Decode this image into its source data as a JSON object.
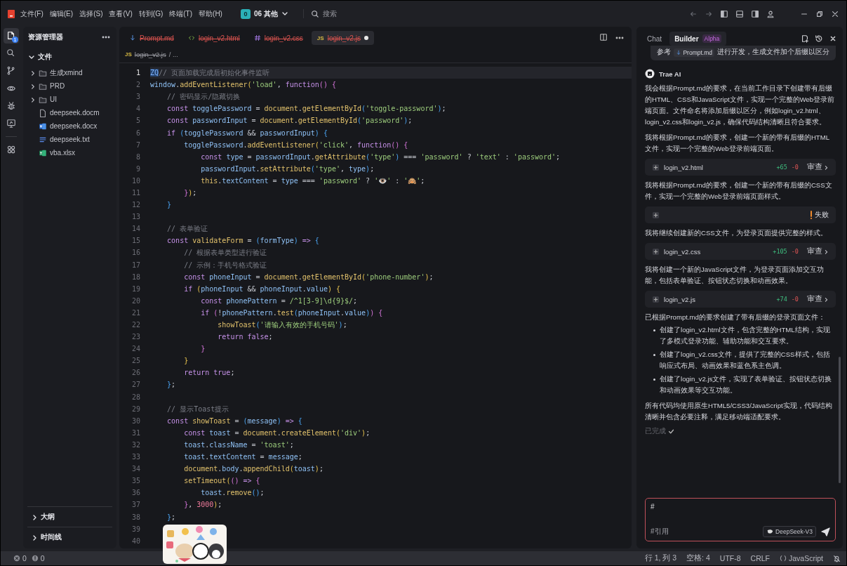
{
  "menu": [
    "文件(F)",
    "编辑(E)",
    "选择(S)",
    "查看(V)",
    "转到(G)",
    "终端(T)",
    "帮助(H)"
  ],
  "workspace": {
    "initial": "0",
    "name": "06 其他"
  },
  "search": {
    "placeholder": "搜索"
  },
  "activity_bar": [
    {
      "selected": true,
      "badge": "1"
    },
    {
      "selected": false
    },
    {
      "selected": false
    },
    {
      "selected": false
    },
    {
      "selected": false
    },
    {
      "selected": false
    },
    {
      "selected": false
    }
  ],
  "explorer": {
    "title": "资源管理器",
    "section": {
      "label": "文件",
      "expanded": true
    },
    "items": [
      {
        "name": "生成xmind",
        "kind": "folder",
        "expanded": false
      },
      {
        "name": "PRD",
        "kind": "folder",
        "expanded": false
      },
      {
        "name": "UI",
        "kind": "folder",
        "expanded": false
      },
      {
        "name": "deepseek.docm",
        "kind": "file"
      },
      {
        "name": "deepseek.docx",
        "kind": "word"
      },
      {
        "name": "deepseek.txt",
        "kind": "text"
      },
      {
        "name": "vba.xlsx",
        "kind": "excel"
      }
    ],
    "panels": [
      {
        "label": "大纲",
        "expanded": false
      },
      {
        "label": "时间线",
        "expanded": false
      }
    ]
  },
  "tabs": [
    {
      "label": "Prompt.md",
      "kind": "md",
      "selected": false,
      "deleted": true,
      "modified": false
    },
    {
      "label": "login_v2.html",
      "kind": "html",
      "selected": false,
      "deleted": true,
      "modified": false
    },
    {
      "label": "login_v2.css",
      "kind": "css",
      "selected": false,
      "deleted": true,
      "modified": false
    },
    {
      "label": "login_v2.js",
      "kind": "js",
      "icon_text": "JS",
      "selected": true,
      "deleted": true,
      "modified": true
    }
  ],
  "breadcrumb": {
    "icon_text": "JS",
    "file": "login_v2.js",
    "deleted": true,
    "rest": "/ ..."
  },
  "editor": {
    "lines": [
      {
        "n": "1",
        "selected": true,
        "tokens": [
          {
            "kind": "sel",
            "text": "ZQ"
          },
          {
            "kind": "cm",
            "text": "// 页面加载完成后初始化事件监听"
          }
        ]
      },
      {
        "n": "2",
        "selected": false,
        "tokens": [
          {
            "kind": "var",
            "text": "window"
          },
          {
            "kind": "p",
            "text": "."
          },
          {
            "kind": "fn",
            "text": "addEventListener"
          },
          {
            "kind": "b1",
            "text": "("
          },
          {
            "kind": "str",
            "text": "'load'"
          },
          {
            "kind": "p",
            "text": ", "
          },
          {
            "kind": "kw",
            "text": "function"
          },
          {
            "kind": "b2",
            "text": "()"
          },
          {
            "kind": "b2",
            "text": " {"
          }
        ]
      },
      {
        "n": "3",
        "selected": false,
        "tokens": [
          {
            "kind": "cm",
            "text": "    // 密码显示/隐藏切换"
          }
        ]
      },
      {
        "n": "4",
        "selected": false,
        "tokens": [
          {
            "kind": "kw",
            "text": "    const "
          },
          {
            "kind": "var",
            "text": "togglePassword"
          },
          {
            "kind": "p",
            "text": " = "
          },
          {
            "kind": "fn",
            "text": "document"
          },
          {
            "kind": "p",
            "text": "."
          },
          {
            "kind": "fn",
            "text": "getElementById"
          },
          {
            "kind": "b3",
            "text": "("
          },
          {
            "kind": "str",
            "text": "'toggle-password'"
          },
          {
            "kind": "b3",
            "text": ")"
          },
          {
            "kind": "p",
            "text": ";"
          }
        ]
      },
      {
        "n": "5",
        "selected": false,
        "tokens": [
          {
            "kind": "kw",
            "text": "    const "
          },
          {
            "kind": "var",
            "text": "passwordInput"
          },
          {
            "kind": "p",
            "text": " = "
          },
          {
            "kind": "fn",
            "text": "document"
          },
          {
            "kind": "p",
            "text": "."
          },
          {
            "kind": "fn",
            "text": "getElementById"
          },
          {
            "kind": "b3",
            "text": "("
          },
          {
            "kind": "str",
            "text": "'password'"
          },
          {
            "kind": "b3",
            "text": ")"
          },
          {
            "kind": "p",
            "text": ";"
          }
        ]
      },
      {
        "n": "6",
        "selected": false,
        "tokens": [
          {
            "kind": "kw",
            "text": "    if "
          },
          {
            "kind": "b3",
            "text": "("
          },
          {
            "kind": "var",
            "text": "togglePassword"
          },
          {
            "kind": "p",
            "text": " && "
          },
          {
            "kind": "var",
            "text": "passwordInput"
          },
          {
            "kind": "b3",
            "text": ")"
          },
          {
            "kind": "b3",
            "text": " {"
          }
        ]
      },
      {
        "n": "7",
        "selected": false,
        "tokens": [
          {
            "kind": "var",
            "text": "        togglePassword"
          },
          {
            "kind": "p",
            "text": "."
          },
          {
            "kind": "fn",
            "text": "addEventListener"
          },
          {
            "kind": "b1",
            "text": "("
          },
          {
            "kind": "str",
            "text": "'click'"
          },
          {
            "kind": "p",
            "text": ", "
          },
          {
            "kind": "kw",
            "text": "function"
          },
          {
            "kind": "b2",
            "text": "()"
          },
          {
            "kind": "b2",
            "text": " {"
          }
        ]
      },
      {
        "n": "8",
        "selected": false,
        "tokens": [
          {
            "kind": "kw",
            "text": "            const "
          },
          {
            "kind": "var",
            "text": "type"
          },
          {
            "kind": "p",
            "text": " = "
          },
          {
            "kind": "var",
            "text": "passwordInput"
          },
          {
            "kind": "p",
            "text": "."
          },
          {
            "kind": "fn",
            "text": "getAttribute"
          },
          {
            "kind": "b3",
            "text": "("
          },
          {
            "kind": "str",
            "text": "'type'"
          },
          {
            "kind": "b3",
            "text": ")"
          },
          {
            "kind": "p",
            "text": " === "
          },
          {
            "kind": "str",
            "text": "'password'"
          },
          {
            "kind": "p",
            "text": " ? "
          },
          {
            "kind": "str",
            "text": "'text'"
          },
          {
            "kind": "p",
            "text": " : "
          },
          {
            "kind": "str",
            "text": "'password'"
          },
          {
            "kind": "p",
            "text": ";"
          }
        ]
      },
      {
        "n": "9",
        "selected": false,
        "tokens": [
          {
            "kind": "var",
            "text": "            passwordInput"
          },
          {
            "kind": "p",
            "text": "."
          },
          {
            "kind": "fn",
            "text": "setAttribute"
          },
          {
            "kind": "b3",
            "text": "("
          },
          {
            "kind": "str",
            "text": "'type'"
          },
          {
            "kind": "p",
            "text": ", "
          },
          {
            "kind": "var",
            "text": "type"
          },
          {
            "kind": "b3",
            "text": ")"
          },
          {
            "kind": "p",
            "text": ";"
          }
        ]
      },
      {
        "n": "10",
        "selected": false,
        "tokens": [
          {
            "kind": "fn",
            "text": "            this"
          },
          {
            "kind": "p",
            "text": "."
          },
          {
            "kind": "var",
            "text": "textContent"
          },
          {
            "kind": "p",
            "text": " = "
          },
          {
            "kind": "var",
            "text": "type"
          },
          {
            "kind": "p",
            "text": " === "
          },
          {
            "kind": "str",
            "text": "'password'"
          },
          {
            "kind": "p",
            "text": " ? "
          },
          {
            "kind": "str",
            "text": "'👁️'"
          },
          {
            "kind": "p",
            "text": " : "
          },
          {
            "kind": "str",
            "text": "'🙈'"
          },
          {
            "kind": "p",
            "text": ";"
          }
        ]
      },
      {
        "n": "11",
        "selected": false,
        "tokens": [
          {
            "kind": "b2",
            "text": "        }"
          },
          {
            "kind": "b1",
            "text": ")"
          },
          {
            "kind": "p",
            "text": ";"
          }
        ]
      },
      {
        "n": "12",
        "selected": false,
        "tokens": [
          {
            "kind": "b3",
            "text": "    }"
          }
        ]
      },
      {
        "n": "13",
        "selected": false
      },
      {
        "n": "14",
        "selected": false,
        "tokens": [
          {
            "kind": "cm",
            "text": "    // 表单验证"
          }
        ]
      },
      {
        "n": "15",
        "selected": false,
        "tokens": [
          {
            "kind": "kw",
            "text": "    const "
          },
          {
            "kind": "fn",
            "text": "validateForm"
          },
          {
            "kind": "p",
            "text": " = "
          },
          {
            "kind": "b3",
            "text": "("
          },
          {
            "kind": "var",
            "text": "formType"
          },
          {
            "kind": "b3",
            "text": ")"
          },
          {
            "kind": "kw",
            "text": " => "
          },
          {
            "kind": "b3",
            "text": "{"
          }
        ]
      },
      {
        "n": "16",
        "selected": false,
        "tokens": [
          {
            "kind": "cm",
            "text": "        // 根据表单类型进行验证"
          }
        ]
      },
      {
        "n": "17",
        "selected": false,
        "tokens": [
          {
            "kind": "cm",
            "text": "        // 示例：手机号格式验证"
          }
        ]
      },
      {
        "n": "18",
        "selected": false,
        "tokens": [
          {
            "kind": "kw",
            "text": "        const "
          },
          {
            "kind": "var",
            "text": "phoneInput"
          },
          {
            "kind": "p",
            "text": " = "
          },
          {
            "kind": "fn",
            "text": "document"
          },
          {
            "kind": "p",
            "text": "."
          },
          {
            "kind": "fn",
            "text": "getElementById"
          },
          {
            "kind": "b1",
            "text": "("
          },
          {
            "kind": "str",
            "text": "'phone-number'"
          },
          {
            "kind": "b1",
            "text": ")"
          },
          {
            "kind": "p",
            "text": ";"
          }
        ]
      },
      {
        "n": "19",
        "selected": false,
        "tokens": [
          {
            "kind": "kw",
            "text": "        if "
          },
          {
            "kind": "b1",
            "text": "("
          },
          {
            "kind": "var",
            "text": "phoneInput"
          },
          {
            "kind": "p",
            "text": " && "
          },
          {
            "kind": "var",
            "text": "phoneInput"
          },
          {
            "kind": "p",
            "text": "."
          },
          {
            "kind": "var",
            "text": "value"
          },
          {
            "kind": "b1",
            "text": ")"
          },
          {
            "kind": "b1",
            "text": " {"
          }
        ]
      },
      {
        "n": "20",
        "selected": false,
        "tokens": [
          {
            "kind": "kw",
            "text": "            const "
          },
          {
            "kind": "var",
            "text": "phonePattern"
          },
          {
            "kind": "p",
            "text": " = "
          },
          {
            "kind": "str",
            "text": "/^1[3-9]\\d{9}$/"
          },
          {
            "kind": "p",
            "text": ";"
          }
        ]
      },
      {
        "n": "21",
        "selected": false,
        "tokens": [
          {
            "kind": "kw",
            "text": "            if "
          },
          {
            "kind": "b2",
            "text": "("
          },
          {
            "kind": "p",
            "text": "!"
          },
          {
            "kind": "var",
            "text": "phonePattern"
          },
          {
            "kind": "p",
            "text": "."
          },
          {
            "kind": "fn",
            "text": "test"
          },
          {
            "kind": "b3",
            "text": "("
          },
          {
            "kind": "var",
            "text": "phoneInput"
          },
          {
            "kind": "p",
            "text": "."
          },
          {
            "kind": "var",
            "text": "value"
          },
          {
            "kind": "b3",
            "text": ")"
          },
          {
            "kind": "b2",
            "text": ")"
          },
          {
            "kind": "b2",
            "text": " {"
          }
        ]
      },
      {
        "n": "22",
        "selected": false,
        "tokens": [
          {
            "kind": "fn",
            "text": "                showToast"
          },
          {
            "kind": "b3",
            "text": "("
          },
          {
            "kind": "str",
            "text": "'请输入有效的手机号码'"
          },
          {
            "kind": "b3",
            "text": ")"
          },
          {
            "kind": "p",
            "text": ";"
          }
        ]
      },
      {
        "n": "23",
        "selected": false,
        "tokens": [
          {
            "kind": "kw",
            "text": "                return "
          },
          {
            "kind": "kw",
            "text": "false"
          },
          {
            "kind": "p",
            "text": ";"
          }
        ]
      },
      {
        "n": "24",
        "selected": false,
        "tokens": [
          {
            "kind": "b2",
            "text": "            }"
          }
        ]
      },
      {
        "n": "25",
        "selected": false,
        "tokens": [
          {
            "kind": "b1",
            "text": "        }"
          }
        ]
      },
      {
        "n": "26",
        "selected": false,
        "tokens": [
          {
            "kind": "kw",
            "text": "        return "
          },
          {
            "kind": "kw",
            "text": "true"
          },
          {
            "kind": "p",
            "text": ";"
          }
        ]
      },
      {
        "n": "27",
        "selected": false,
        "tokens": [
          {
            "kind": "b3",
            "text": "    }"
          },
          {
            "kind": "p",
            "text": ";"
          }
        ]
      },
      {
        "n": "28",
        "selected": false
      },
      {
        "n": "29",
        "selected": false,
        "tokens": [
          {
            "kind": "cm",
            "text": "    // 显示Toast提示"
          }
        ]
      },
      {
        "n": "30",
        "selected": false,
        "tokens": [
          {
            "kind": "kw",
            "text": "    const "
          },
          {
            "kind": "fn",
            "text": "showToast"
          },
          {
            "kind": "p",
            "text": " = "
          },
          {
            "kind": "b3",
            "text": "("
          },
          {
            "kind": "var",
            "text": "message"
          },
          {
            "kind": "b3",
            "text": ")"
          },
          {
            "kind": "kw",
            "text": " => "
          },
          {
            "kind": "b3",
            "text": "{"
          }
        ]
      },
      {
        "n": "31",
        "selected": false,
        "tokens": [
          {
            "kind": "kw",
            "text": "        const "
          },
          {
            "kind": "var",
            "text": "toast"
          },
          {
            "kind": "p",
            "text": " = "
          },
          {
            "kind": "fn",
            "text": "document"
          },
          {
            "kind": "p",
            "text": "."
          },
          {
            "kind": "fn",
            "text": "createElement"
          },
          {
            "kind": "b1",
            "text": "("
          },
          {
            "kind": "str",
            "text": "'div'"
          },
          {
            "kind": "b1",
            "text": ")"
          },
          {
            "kind": "p",
            "text": ";"
          }
        ]
      },
      {
        "n": "32",
        "selected": false,
        "tokens": [
          {
            "kind": "var",
            "text": "        toast"
          },
          {
            "kind": "p",
            "text": "."
          },
          {
            "kind": "var",
            "text": "className"
          },
          {
            "kind": "p",
            "text": " = "
          },
          {
            "kind": "str",
            "text": "'toast'"
          },
          {
            "kind": "p",
            "text": ";"
          }
        ]
      },
      {
        "n": "33",
        "selected": false,
        "tokens": [
          {
            "kind": "var",
            "text": "        toast"
          },
          {
            "kind": "p",
            "text": "."
          },
          {
            "kind": "var",
            "text": "textContent"
          },
          {
            "kind": "p",
            "text": " = "
          },
          {
            "kind": "var",
            "text": "message"
          },
          {
            "kind": "p",
            "text": ";"
          }
        ]
      },
      {
        "n": "34",
        "selected": false,
        "tokens": [
          {
            "kind": "fn",
            "text": "        document"
          },
          {
            "kind": "p",
            "text": "."
          },
          {
            "kind": "var",
            "text": "body"
          },
          {
            "kind": "p",
            "text": "."
          },
          {
            "kind": "fn",
            "text": "appendChild"
          },
          {
            "kind": "b1",
            "text": "("
          },
          {
            "kind": "var",
            "text": "toast"
          },
          {
            "kind": "b1",
            "text": ")"
          },
          {
            "kind": "p",
            "text": ";"
          }
        ]
      },
      {
        "n": "35",
        "selected": false,
        "tokens": [
          {
            "kind": "fn",
            "text": "        setTimeout"
          },
          {
            "kind": "b1",
            "text": "("
          },
          {
            "kind": "b2",
            "text": "()"
          },
          {
            "kind": "kw",
            "text": " => "
          },
          {
            "kind": "b2",
            "text": "{"
          }
        ]
      },
      {
        "n": "36",
        "selected": false,
        "tokens": [
          {
            "kind": "var",
            "text": "            toast"
          },
          {
            "kind": "p",
            "text": "."
          },
          {
            "kind": "fn",
            "text": "remove"
          },
          {
            "kind": "b3",
            "text": "()"
          },
          {
            "kind": "p",
            "text": ";"
          }
        ]
      },
      {
        "n": "37",
        "selected": false,
        "tokens": [
          {
            "kind": "b2",
            "text": "        }"
          },
          {
            "kind": "p",
            "text": ", "
          },
          {
            "kind": "num",
            "text": "3000"
          },
          {
            "kind": "b1",
            "text": ")"
          },
          {
            "kind": "p",
            "text": ";"
          }
        ]
      },
      {
        "n": "38",
        "selected": false,
        "tokens": [
          {
            "kind": "b3",
            "text": "    }"
          },
          {
            "kind": "p",
            "text": ";"
          }
        ]
      },
      {
        "n": "39",
        "selected": false
      },
      {
        "n": "40",
        "selected": false
      }
    ]
  },
  "chat": {
    "tabs": [
      {
        "label": "Chat",
        "selected": false
      },
      {
        "label": "Builder",
        "badge": "Alpha",
        "selected": true
      }
    ],
    "user_message": [
      {
        "kind": "text",
        "text": "参考"
      },
      {
        "kind": "file",
        "text": "Prompt.md"
      },
      {
        "kind": "text",
        "text": "进行开发，生成文件加个后缀以区分"
      }
    ],
    "assistant": "Trae AI",
    "messages": [
      {
        "kind": "text",
        "text": "我会根据Prompt.md的要求，在当前工作目录下创建带有后缀的HTML、CSS和JavaScript文件，实现一个完整的Web登录前端页面。文件命名将添加后缀以区分，例如login_v2.html、login_v2.css和login_v2.js，确保代码结构清晰且符合要求。"
      },
      {
        "kind": "text",
        "text": "我将根据Prompt.md的要求，创建一个新的带有后缀的HTML文件，实现一个完整的Web登录前端页面。"
      },
      {
        "kind": "file",
        "name": "login_v2.html",
        "added": "+65",
        "removed": "-0",
        "action": "审查"
      },
      {
        "kind": "text",
        "text": "我将根据Prompt.md的要求，创建一个新的带有后缀的CSS文件，实现一个完整的Web登录前端页面样式。"
      },
      {
        "kind": "error",
        "status": "失败"
      },
      {
        "kind": "text",
        "text": "我将继续创建新的CSS文件，为登录页面提供完整的样式。"
      },
      {
        "kind": "file",
        "name": "login_v2.css",
        "added": "+105",
        "removed": "-0",
        "action": "审查"
      },
      {
        "kind": "text",
        "text": "我将创建一个新的JavaScript文件，为登录页面添加交互功能，包括表单验证、按钮状态切换和动画效果。"
      },
      {
        "kind": "file",
        "name": "login_v2.js",
        "added": "+74",
        "removed": "-0",
        "action": "审查"
      },
      {
        "kind": "text",
        "text": "已根据Prompt.md的要求创建了带有后缀的登录页面文件："
      },
      {
        "kind": "list",
        "items": [
          "创建了login_v2.html文件，包含完整的HTML结构，实现了多模式登录功能、辅助功能和交互要求。",
          "创建了login_v2.css文件，提供了完整的CSS样式，包括响应式布局、动画效果和蓝色系主色调。",
          "创建了login_v2.js文件，实现了表单验证、按钮状态切换和动画效果等交互功能。"
        ]
      },
      {
        "kind": "text",
        "text": "所有代码均使用原生HTML5/CSS3/JavaScript实现，代码结构清晰并包含必要注释，满足移动端适配要求。"
      },
      {
        "kind": "done",
        "text": "已完成"
      }
    ],
    "input": {
      "value": "#",
      "reference": "#引用",
      "model": "DeepSeek-V3"
    }
  },
  "status_bar": {
    "errors": "0",
    "warnings": "0",
    "items": [
      "行 1, 列 3",
      "空格: 4",
      "UTF-8",
      "CRLF"
    ],
    "language": "JavaScript"
  }
}
